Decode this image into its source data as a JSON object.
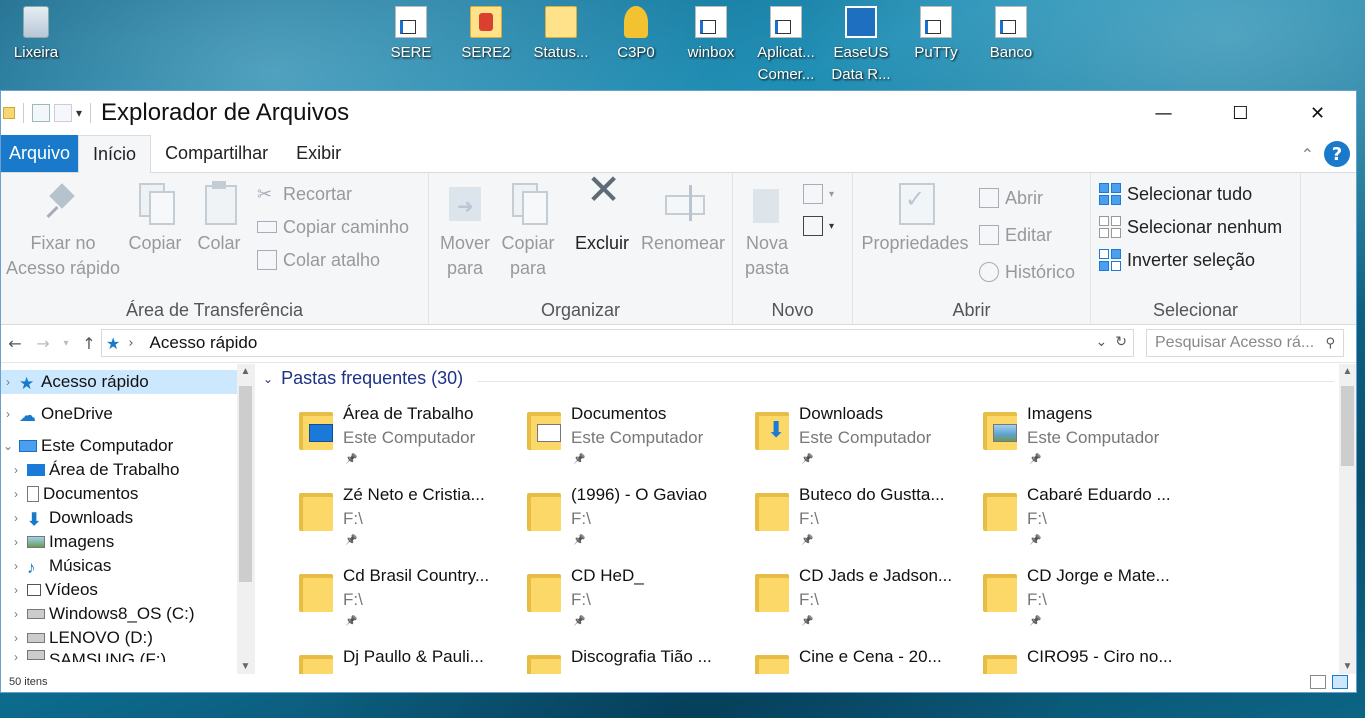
{
  "desktop": {
    "icons": [
      {
        "label": "Lixeira"
      },
      {
        "label": "SERE"
      },
      {
        "label": "SERE2"
      },
      {
        "label": "Status..."
      },
      {
        "label": "C3P0"
      },
      {
        "label": "winbox"
      },
      {
        "label": "Aplicat... Comer..."
      },
      {
        "label": "EaseUS Data R..."
      },
      {
        "label": "PuTTy"
      },
      {
        "label": "Banco"
      }
    ]
  },
  "window": {
    "title": "Explorador de Arquivos",
    "controls": {
      "minimize": "—",
      "maximize": "☐",
      "close": "✕"
    }
  },
  "tabs": {
    "file": "Arquivo",
    "items": [
      "Início",
      "Compartilhar",
      "Exibir"
    ]
  },
  "ribbon": {
    "clipboard": {
      "label": "Área de Transferência",
      "pin": "Fixar no Acesso rápido",
      "copy": "Copiar",
      "paste": "Colar",
      "cut": "Recortar",
      "copy_path": "Copiar caminho",
      "paste_shortcut": "Colar atalho"
    },
    "organize": {
      "label": "Organizar",
      "move_to": "Mover para",
      "copy_to": "Copiar para",
      "delete": "Excluir",
      "rename": "Renomear"
    },
    "new": {
      "label": "Novo",
      "new_folder": "Nova pasta"
    },
    "open": {
      "label": "Abrir",
      "properties": "Propriedades",
      "open": "Abrir",
      "edit": "Editar",
      "history": "Histórico"
    },
    "select": {
      "label": "Selecionar",
      "select_all": "Selecionar tudo",
      "select_none": "Selecionar nenhum",
      "invert": "Inverter seleção"
    }
  },
  "address": {
    "path": "Acesso rápido",
    "search_placeholder": "Pesquisar Acesso rá..."
  },
  "nav": {
    "items": [
      {
        "label": "Acesso rápido",
        "icon": "star-icon"
      },
      {
        "label": "OneDrive",
        "icon": "cloud-icon"
      },
      {
        "label": "Este Computador",
        "icon": "computer-icon"
      },
      {
        "label": "Área de Trabalho",
        "icon": "desktop-icon"
      },
      {
        "label": "Documentos",
        "icon": "documents-icon"
      },
      {
        "label": "Downloads",
        "icon": "download-icon"
      },
      {
        "label": "Imagens",
        "icon": "pictures-icon"
      },
      {
        "label": "Músicas",
        "icon": "music-icon"
      },
      {
        "label": "Vídeos",
        "icon": "video-icon"
      },
      {
        "label": "Windows8_OS (C:)",
        "icon": "drive-icon"
      },
      {
        "label": "LENOVO (D:)",
        "icon": "drive-icon"
      },
      {
        "label": "SAMSUNG (F:)",
        "icon": "drive-icon"
      }
    ]
  },
  "content": {
    "section_title": "Pastas frequentes (30)",
    "folders": [
      {
        "name": "Área de Trabalho",
        "location": "Este Computador",
        "kind": "desktop"
      },
      {
        "name": "Documentos",
        "location": "Este Computador",
        "kind": "docs"
      },
      {
        "name": "Downloads",
        "location": "Este Computador",
        "kind": "downloads"
      },
      {
        "name": "Imagens",
        "location": "Este Computador",
        "kind": "images"
      },
      {
        "name": "Zé Neto e Cristia...",
        "location": "F:\\",
        "kind": "plain"
      },
      {
        "name": "(1996) - O Gaviao",
        "location": "F:\\",
        "kind": "plain"
      },
      {
        "name": "Buteco do Gustta...",
        "location": "F:\\",
        "kind": "plain"
      },
      {
        "name": "Cabaré Eduardo ...",
        "location": "F:\\",
        "kind": "plain"
      },
      {
        "name": "Cd Brasil Country...",
        "location": "F:\\",
        "kind": "plain"
      },
      {
        "name": "CD HeD_",
        "location": "F:\\",
        "kind": "plain"
      },
      {
        "name": "CD Jads e Jadson...",
        "location": "F:\\",
        "kind": "plain"
      },
      {
        "name": "CD Jorge e Mate...",
        "location": "F:\\",
        "kind": "plain"
      },
      {
        "name": "Dj Paullo & Pauli...",
        "location": "",
        "kind": "plain"
      },
      {
        "name": "Discografia Tião ...",
        "location": "",
        "kind": "plain"
      },
      {
        "name": "Cine e Cena - 20...",
        "location": "",
        "kind": "plain"
      },
      {
        "name": "CIRO95 - Ciro no...",
        "location": "",
        "kind": "plain"
      }
    ]
  },
  "status": {
    "items_count": "50 itens"
  }
}
